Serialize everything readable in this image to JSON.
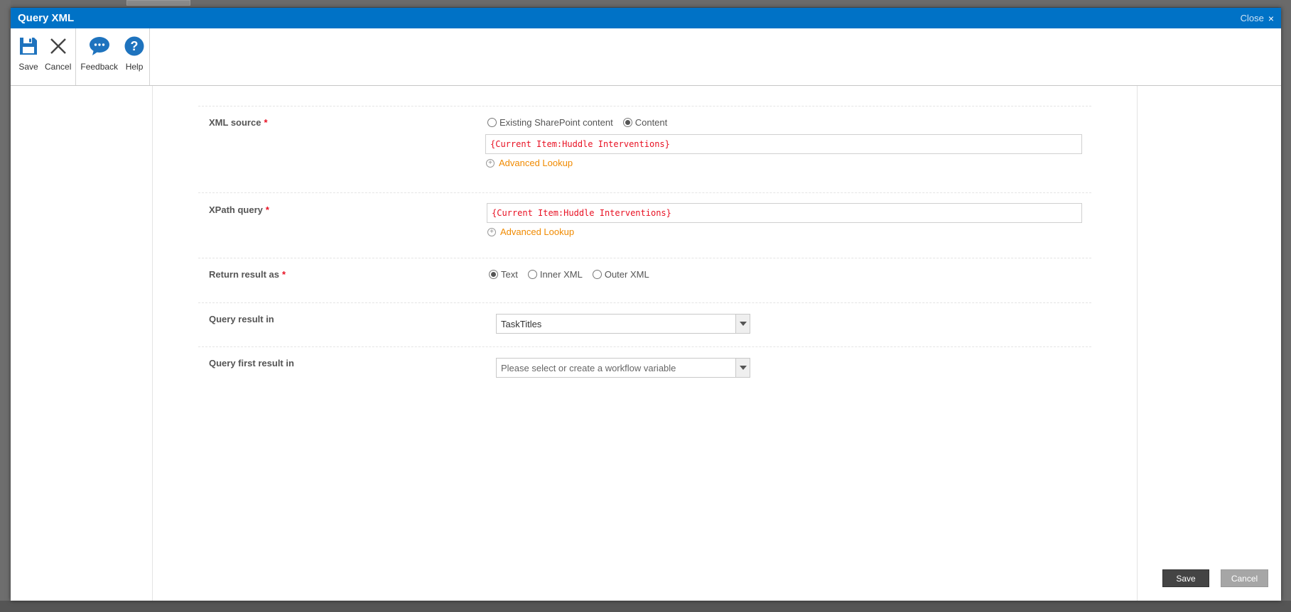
{
  "dialog": {
    "title": "Query XML",
    "close_label": "Close",
    "close_icon": "×"
  },
  "ribbon": {
    "save_label": "Save",
    "cancel_label": "Cancel",
    "feedback_label": "Feedback",
    "help_label": "Help"
  },
  "form": {
    "xml_source": {
      "label": "XML source",
      "options": [
        "Existing SharePoint content",
        "Content"
      ],
      "selected": "Content",
      "value": "{Current Item:Huddle Interventions}",
      "lookup_label": "Advanced Lookup"
    },
    "xpath_query": {
      "label": "XPath query",
      "value": "{Current Item:Huddle Interventions}",
      "lookup_label": "Advanced Lookup"
    },
    "return_result_as": {
      "label": "Return result as",
      "options": [
        "Text",
        "Inner XML",
        "Outer XML"
      ],
      "selected": "Text"
    },
    "query_result_in": {
      "label": "Query result in",
      "value": "TaskTitles"
    },
    "query_first_result_in": {
      "label": "Query first result in",
      "placeholder": "Please select or create a workflow variable"
    },
    "required_marker": "*"
  },
  "footer": {
    "save_label": "Save",
    "cancel_label": "Cancel"
  },
  "colors": {
    "titlebar": "#0072c6",
    "accent_icon": "#1e73be",
    "required": "#e81123",
    "lookup": "#f08a00"
  }
}
